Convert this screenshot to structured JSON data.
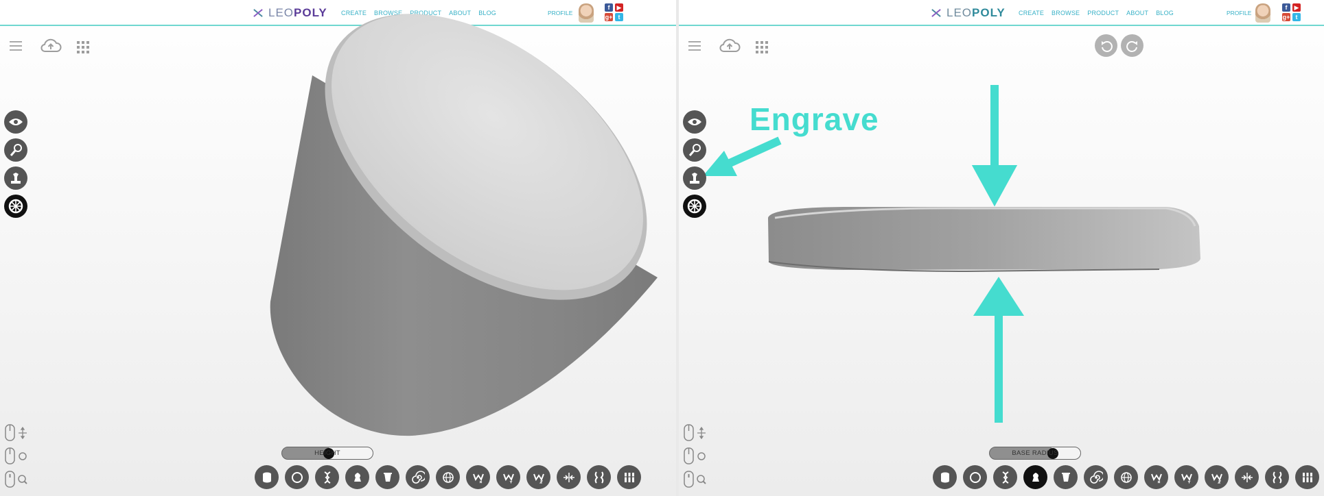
{
  "left": {
    "brand": {
      "leo": "LEO",
      "poly": "POLY"
    },
    "nav": [
      "CREATE",
      "BROWSE",
      "PRODUCT",
      "ABOUT",
      "BLOG"
    ],
    "profile_label": "PROFILE",
    "social": [
      "f",
      "▶",
      "g+",
      "t"
    ],
    "slider": {
      "label": "HEIGHT",
      "value": 0.52
    },
    "side_tools": [
      "eye-icon",
      "brush-icon",
      "stamp-icon",
      "wheel-icon"
    ],
    "shape_tools": [
      "cylinder-icon",
      "circle-icon",
      "bulge-icon",
      "pinch-icon",
      "taper-icon",
      "spiral-icon",
      "sphere-icon",
      "wave-x-icon",
      "wave-y-icon",
      "wave-z-icon",
      "compress-icon",
      "twist-icon",
      "columns-icon"
    ],
    "selected_shape": null
  },
  "right": {
    "brand": {
      "leo": "LEO",
      "poly": "POLY"
    },
    "nav": [
      "CREATE",
      "BROWSE",
      "PRODUCT",
      "ABOUT",
      "BLOG"
    ],
    "profile_label": "PROFILE",
    "social": [
      "f",
      "▶",
      "g+",
      "t"
    ],
    "slider": {
      "label": "BASE RADIUS",
      "value": 0.68
    },
    "annotation": "Engrave",
    "selected_shape": 3
  },
  "colors": {
    "accent": "#45dccf",
    "nav": "#36b0c6",
    "button": "#555555",
    "active": "#111111"
  }
}
